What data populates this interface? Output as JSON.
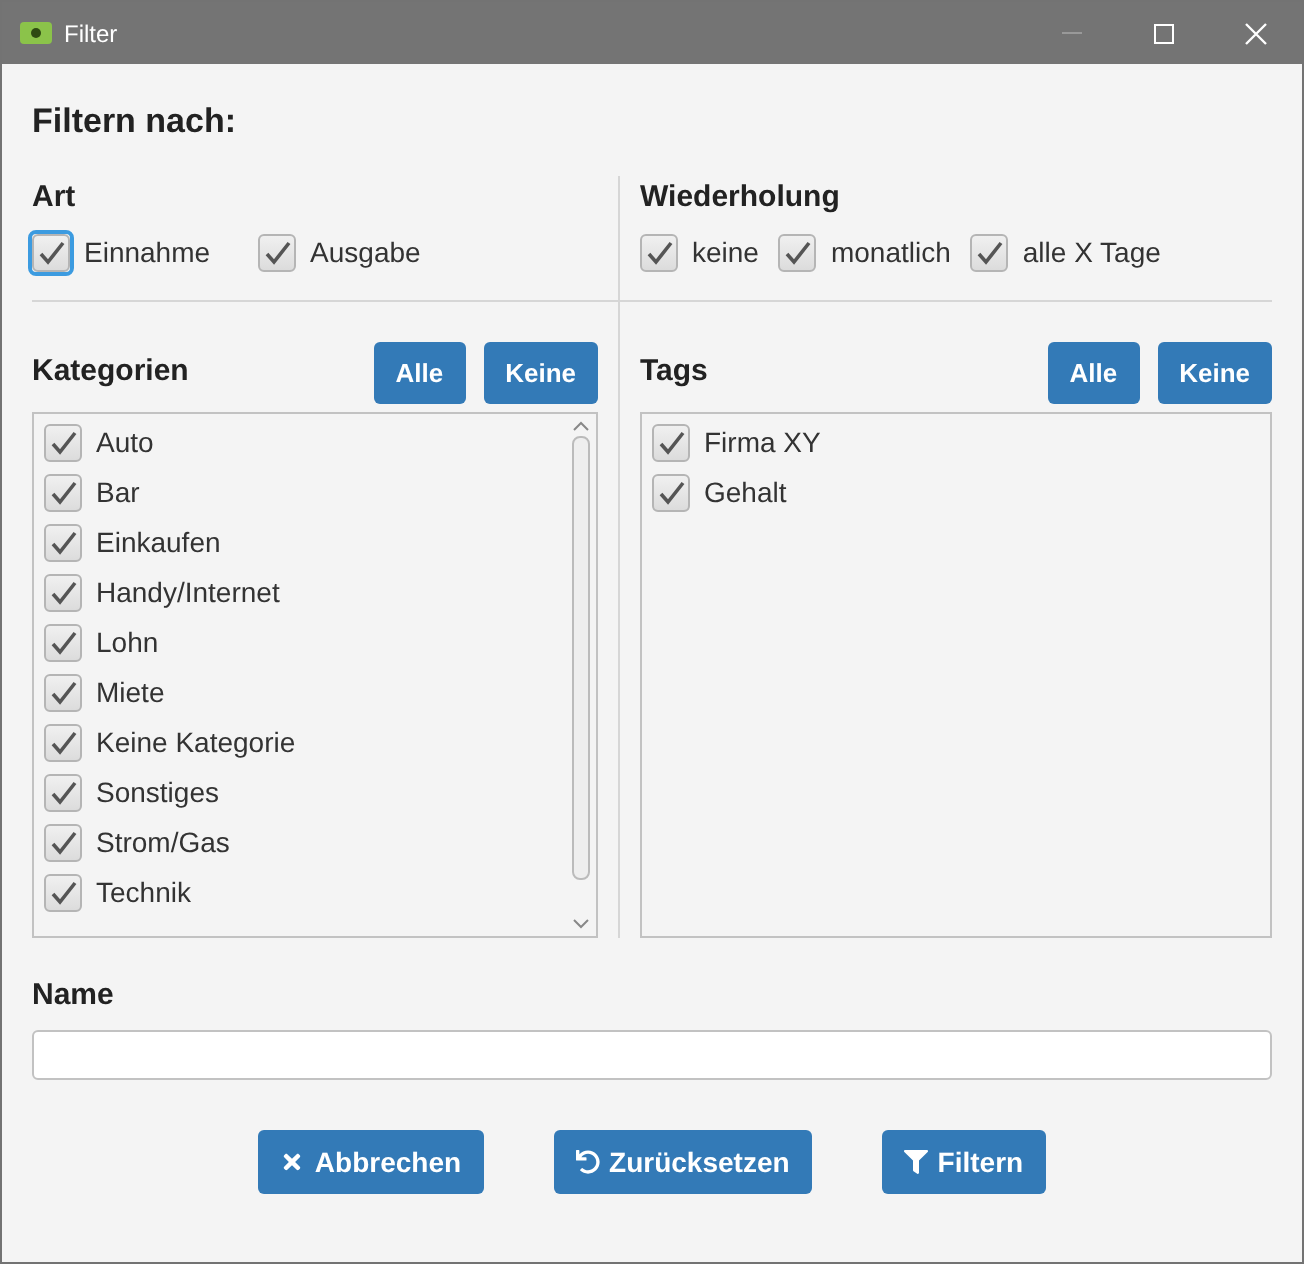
{
  "window": {
    "title": "Filter"
  },
  "heading": "Filtern nach:",
  "art": {
    "label": "Art",
    "options": [
      {
        "label": "Einnahme",
        "checked": true,
        "focused": true
      },
      {
        "label": "Ausgabe",
        "checked": true,
        "focused": false
      }
    ]
  },
  "wiederholung": {
    "label": "Wiederholung",
    "options": [
      {
        "label": "keine",
        "checked": true
      },
      {
        "label": "monatlich",
        "checked": true
      },
      {
        "label": "alle X Tage",
        "checked": true
      }
    ]
  },
  "kategorien": {
    "label": "Kategorien",
    "buttons": [
      "Alle",
      "Keine"
    ],
    "items": [
      {
        "label": "Auto",
        "checked": true
      },
      {
        "label": "Bar",
        "checked": true
      },
      {
        "label": "Einkaufen",
        "checked": true
      },
      {
        "label": "Handy/Internet",
        "checked": true
      },
      {
        "label": "Lohn",
        "checked": true
      },
      {
        "label": "Miete",
        "checked": true
      },
      {
        "label": "Keine Kategorie",
        "checked": true
      },
      {
        "label": "Sonstiges",
        "checked": true
      },
      {
        "label": "Strom/Gas",
        "checked": true
      },
      {
        "label": "Technik",
        "checked": true
      }
    ]
  },
  "tags": {
    "label": "Tags",
    "buttons": [
      "Alle",
      "Keine"
    ],
    "items": [
      {
        "label": "Firma XY",
        "checked": true
      },
      {
        "label": "Gehalt",
        "checked": true
      }
    ]
  },
  "name": {
    "label": "Name"
  },
  "buttons": [
    {
      "label": "Abbrechen",
      "kind": "cancel"
    },
    {
      "label": "Zurücksetzen",
      "kind": "reset"
    },
    {
      "label": "Filtern",
      "kind": "filter"
    }
  ]
}
